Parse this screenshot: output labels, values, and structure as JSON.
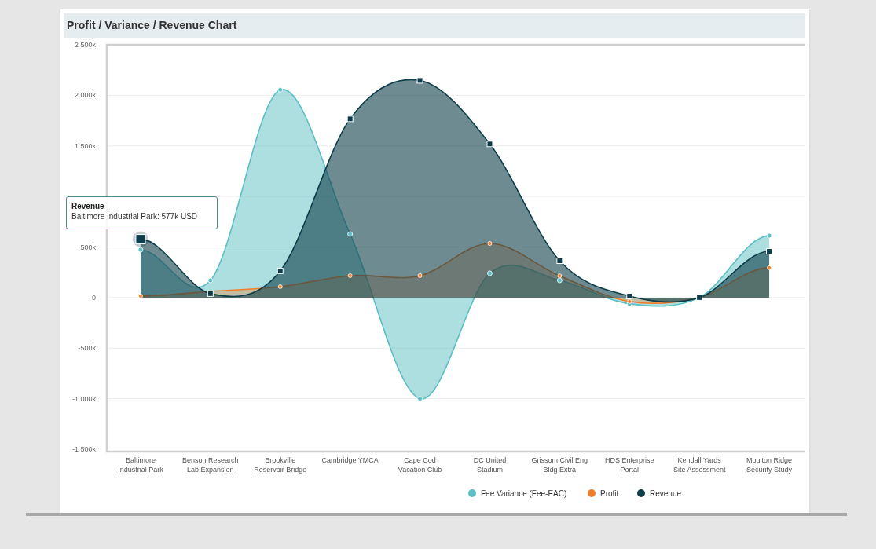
{
  "panel": {
    "title": "Profit / Variance / Revenue Chart",
    "chart_data": {
      "type": "area",
      "categories": [
        "Baltimore\nIndustrial Park",
        "Benson Research\nLab Expansion",
        "Brookville\nReservoir Bridge",
        "Cambridge YMCA",
        "Cape Cod\nVacation Club",
        "DC United\nStadium",
        "Grissom Civil Eng\nBldg Extra",
        "HDS Enterprise\nPortal",
        "Kendall Yards\nSite Assessment",
        "Moulton Ridge\nSecurity Study"
      ],
      "series": [
        {
          "name": "Fee Variance (Fee-EAC)",
          "color": "#5bbfc4",
          "values": [
            473,
            170,
            2054,
            628,
            -1000,
            240,
            170,
            -62,
            0,
            612
          ]
        },
        {
          "name": "Profit",
          "color": "#f07f2b",
          "values": [
            15,
            null,
            108,
            217,
            217,
            535,
            215,
            -39,
            0,
            295
          ]
        },
        {
          "name": "Revenue",
          "color": "#0d3d4a",
          "values": [
            577,
            39,
            264,
            1767,
            2147,
            1519,
            364,
            15,
            0,
            457
          ]
        }
      ],
      "ylim": [
        -1500,
        2500
      ],
      "yticks": [
        {
          "value": 2500,
          "label": "2 500k"
        },
        {
          "value": 2000,
          "label": "2 000k"
        },
        {
          "value": 1500,
          "label": "1 500k"
        },
        {
          "value": 500,
          "label": "500k"
        },
        {
          "value": 0,
          "label": "0"
        },
        {
          "value": -500,
          "label": "-500k"
        },
        {
          "value": -1000,
          "label": "-1 000k"
        },
        {
          "value": -1500,
          "label": "-1 500k"
        }
      ],
      "grid": true,
      "legend": true
    },
    "tooltip": {
      "title": "Revenue",
      "text": "Baltimore Industrial Park: 577k USD"
    }
  }
}
